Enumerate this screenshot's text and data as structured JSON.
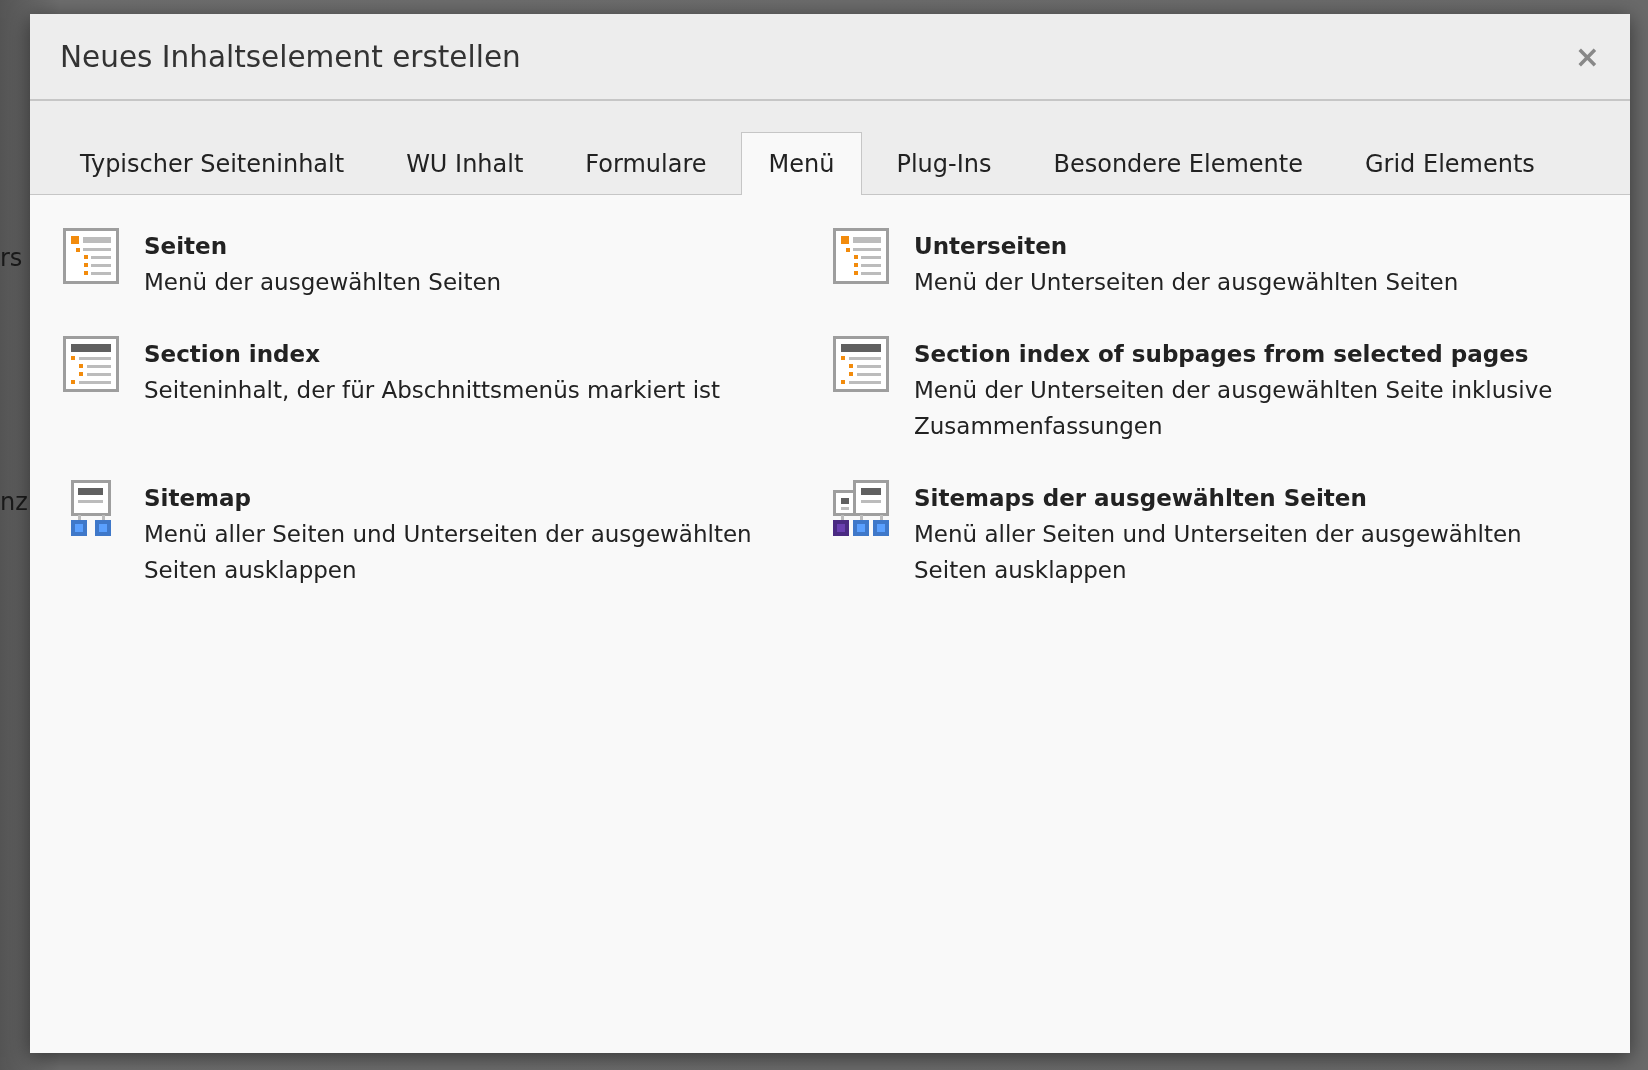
{
  "background": {
    "texts": [
      "rs",
      "nz"
    ]
  },
  "modal": {
    "title": "Neues Inhaltselement erstellen",
    "close": "×"
  },
  "tabs": [
    {
      "label": "Typischer Seiteninhalt",
      "selected": false
    },
    {
      "label": "WU Inhalt",
      "selected": false
    },
    {
      "label": "Formulare",
      "selected": false
    },
    {
      "label": "Menü",
      "selected": true
    },
    {
      "label": "Plug-Ins",
      "selected": false
    },
    {
      "label": "Besondere Elemente",
      "selected": false
    },
    {
      "label": "Grid Elements",
      "selected": false
    }
  ],
  "items": [
    {
      "kind": "pages",
      "title": "Seiten",
      "description": "Menü der ausgewählten Seiten"
    },
    {
      "kind": "pages",
      "title": "Unterseiten",
      "description": "Menü der Unterseiten der ausgewählten Seiten"
    },
    {
      "kind": "section",
      "title": "Section index",
      "description": "Seiteninhalt, der für Abschnittsmenüs markiert ist"
    },
    {
      "kind": "section",
      "title": "Section index of subpages from selected pages",
      "description": "Menü der Unterseiten der ausgewählten Seite inklusive Zusammenfassungen"
    },
    {
      "kind": "sitemap",
      "title": "Sitemap",
      "description": "Menü aller Seiten und Unterseiten der ausgewählten Seiten ausklappen"
    },
    {
      "kind": "sitemaps",
      "title": "Sitemaps der ausgewählten Seiten",
      "description": "Menü aller Seiten und Unterseiten der ausgewählten Seiten ausklappen"
    }
  ]
}
